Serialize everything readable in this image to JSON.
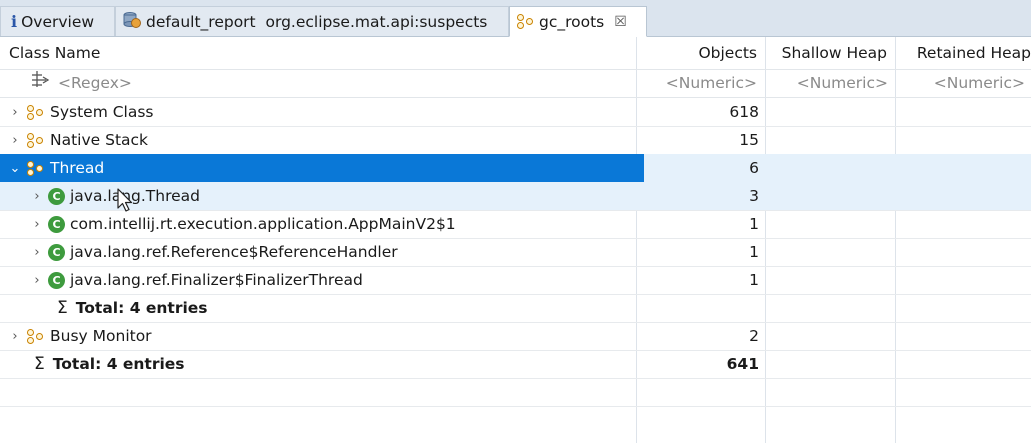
{
  "tabs": [
    {
      "icon": "info-icon",
      "label": "Overview"
    },
    {
      "icon": "report-icon",
      "label": "default_report  org.eclipse.mat.api:suspects"
    },
    {
      "icon": "gc-roots-icon",
      "label": "gc_roots",
      "close": "☒"
    }
  ],
  "columns": {
    "name": "Class Name",
    "objects": "Objects",
    "shallow": "Shallow Heap",
    "retained": "Retained Heap"
  },
  "filters": {
    "name": "<Regex>",
    "objects": "<Numeric>",
    "shallow": "<Numeric>",
    "retained": "<Numeric>"
  },
  "rows": [
    {
      "label": "System Class",
      "objects": "618",
      "icon": "gc-root-icon",
      "expander": "›",
      "level": 0
    },
    {
      "label": "Native Stack",
      "objects": "15",
      "icon": "gc-root-icon",
      "expander": "›",
      "level": 0
    },
    {
      "label": "Thread",
      "objects": "6",
      "icon": "gc-root-icon",
      "expander": "⌄",
      "level": 0,
      "selected": true
    },
    {
      "label": "java.lang.Thread",
      "objects": "3",
      "icon": "class-icon",
      "expander": "›",
      "level": 1,
      "hover": true
    },
    {
      "label": "com.intellij.rt.execution.application.AppMainV2$1",
      "objects": "1",
      "icon": "class-icon",
      "expander": "›",
      "level": 1
    },
    {
      "label": "java.lang.ref.Reference$ReferenceHandler",
      "objects": "1",
      "icon": "class-icon",
      "expander": "›",
      "level": 1
    },
    {
      "label": "java.lang.ref.Finalizer$FinalizerThread",
      "objects": "1",
      "icon": "class-icon",
      "expander": "›",
      "level": 1
    },
    {
      "label": "Total: 4 entries",
      "objects": "",
      "icon": "sigma-icon",
      "level": 1,
      "total": true
    },
    {
      "label": "Busy Monitor",
      "objects": "2",
      "icon": "gc-root-icon",
      "expander": "›",
      "level": 0
    },
    {
      "label": "Total: 4 entries",
      "objects": "641",
      "icon": "sigma-icon",
      "level": 0,
      "total": true
    }
  ],
  "class_icon_letter": "C",
  "sigma": "Σ"
}
